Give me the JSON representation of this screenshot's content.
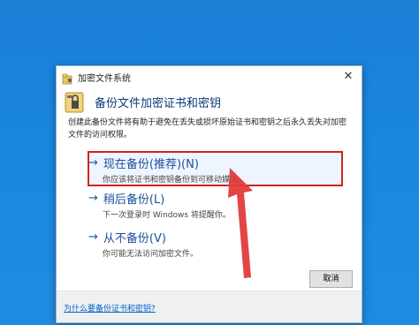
{
  "window": {
    "title": "加密文件系统",
    "close_glyph": "✕"
  },
  "header": {
    "title": "备份文件加密证书和密钥"
  },
  "description": "创建此备份文件将有助于避免在丢失或损坏原始证书和密钥之后永久丢失对加密文件的访问权限。",
  "options": [
    {
      "arrow": "→",
      "title": "现在备份(推荐)(N)",
      "subtitle": "你应该将证书和密钥备份到可移动媒体。"
    },
    {
      "arrow": "→",
      "title": "稍后备份(L)",
      "subtitle": "下一次登录时 Windows 将提醒你。"
    },
    {
      "arrow": "→",
      "title": "从不备份(V)",
      "subtitle": "你可能无法访问加密文件。"
    }
  ],
  "buttons": {
    "cancel": "取消"
  },
  "help_link": "为什么要备份证书和密钥?",
  "colors": {
    "desktop": "#1b7fd6",
    "highlight_border": "#d42020",
    "link": "#0066cc",
    "option_text": "#1b4f9c"
  },
  "icons": {
    "title_icon": "lock-folder-icon",
    "header_icon": "lock-key-icon",
    "option_arrow": "arrow-right-icon",
    "annotation": "red-arrow-annotation"
  }
}
